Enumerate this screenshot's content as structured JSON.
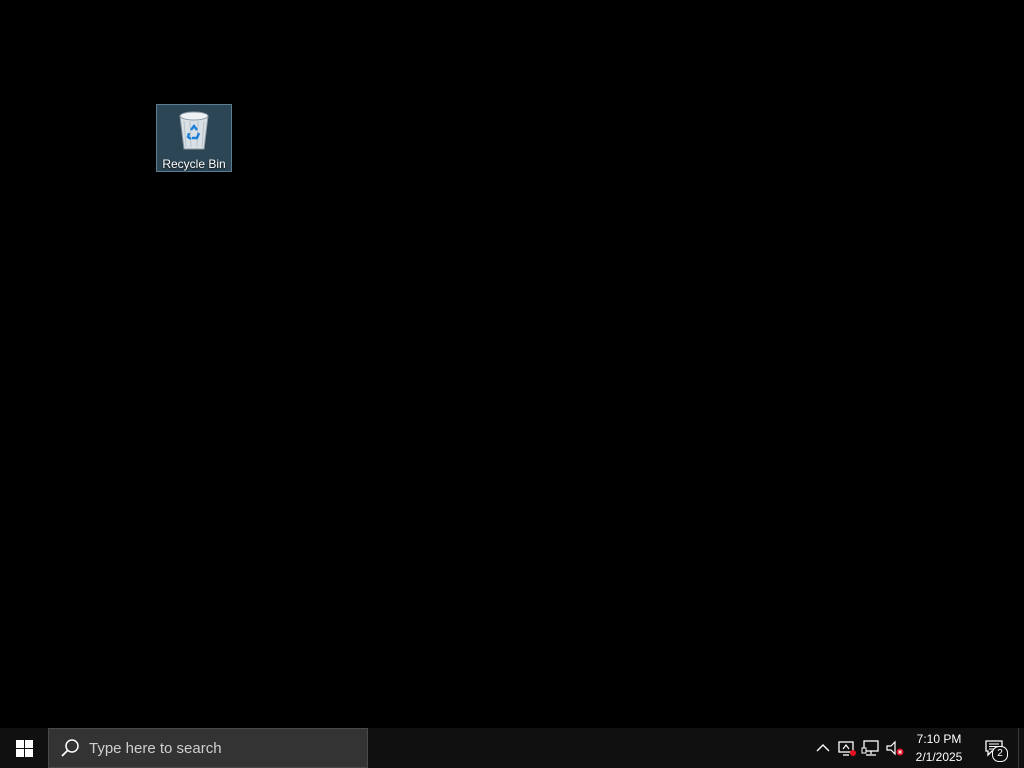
{
  "desktop": {
    "icons": [
      {
        "label": "Recycle Bin",
        "icon": "recycle-bin-icon"
      }
    ]
  },
  "taskbar": {
    "start_icon": "windows-logo-icon",
    "search": {
      "placeholder": "Type here to search",
      "icon": "search-icon"
    },
    "tray": {
      "overflow_icon": "chevron-up-icon",
      "icons": [
        "remote-desktop-icon",
        "network-icon",
        "volume-muted-icon"
      ],
      "time": "7:10 PM",
      "date": "2/1/2025",
      "notification_count": "2",
      "notification_icon": "action-center-icon"
    }
  },
  "colors": {
    "desktop_bg": "#000000",
    "taskbar_bg": "#101010",
    "search_bg": "#333333",
    "selection_bg": "#2d4656",
    "selection_border": "#5a7d92",
    "error_badge": "#e81123"
  }
}
